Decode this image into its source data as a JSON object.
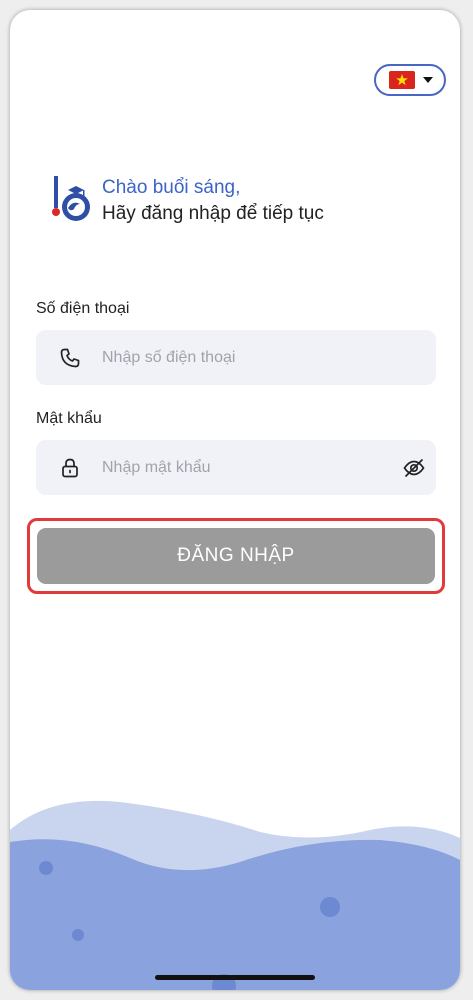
{
  "language": {
    "flag": "vietnam-flag",
    "selected": "Vietnamese"
  },
  "header": {
    "greeting": "Chào buổi sáng,",
    "subtitle": "Hãy đăng nhập để tiếp tục"
  },
  "form": {
    "phone": {
      "label": "Số điện thoại",
      "placeholder": "Nhập số điện thoại",
      "value": ""
    },
    "password": {
      "label": "Mật khẩu",
      "placeholder": "Nhập mật khẩu",
      "value": ""
    },
    "submit_label": "ĐĂNG NHẬP"
  },
  "icons": {
    "phone": "phone-icon",
    "lock": "lock-icon",
    "visibility": "eye-off-icon",
    "dropdown": "caret-down-icon"
  },
  "colors": {
    "accent": "#3d63c8",
    "button_disabled": "#9b9b9b",
    "highlight": "#e03a3a",
    "input_bg": "#f1f2f7",
    "wave_dark": "#8aa2dd",
    "wave_light": "#c9d4ee"
  }
}
